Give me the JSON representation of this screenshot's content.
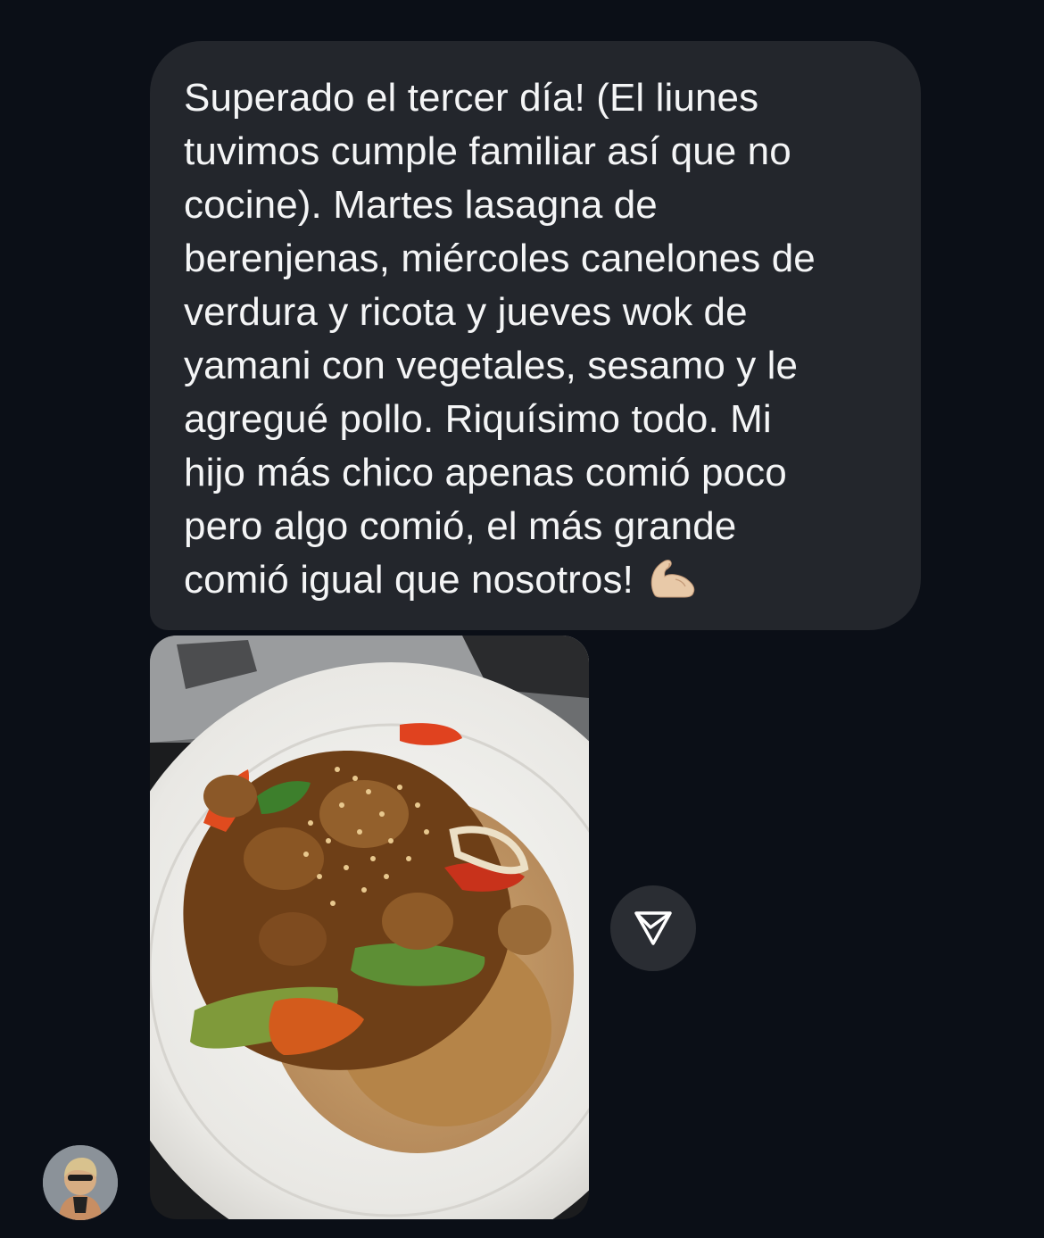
{
  "conversation": {
    "message": {
      "text": "Superado el tercer día! (El liunes\ntuvimos cumple familiar así que no\ncocine). Martes lasagna de\nberenjenas, miércoles canelones de\nverdura y ricota y jueves wok de\nyamani con vegetales, sesamo y le\nagregué pollo. Riquísimo todo. Mi\nhijo más chico apenas comió poco\npero algo comió, el más grande\ncomió igual que nosotros!",
      "emoji": "flexed-biceps-icon"
    },
    "photo": {
      "subject": "food-photo-icon"
    },
    "share_button": {
      "icon": "send-icon"
    },
    "sender": {
      "avatar_icon": "avatar-icon"
    }
  },
  "colors": {
    "background": "#0b0f17",
    "bubble": "#23262c",
    "text": "#f4f5f6",
    "share_button": "#2a2d33"
  }
}
